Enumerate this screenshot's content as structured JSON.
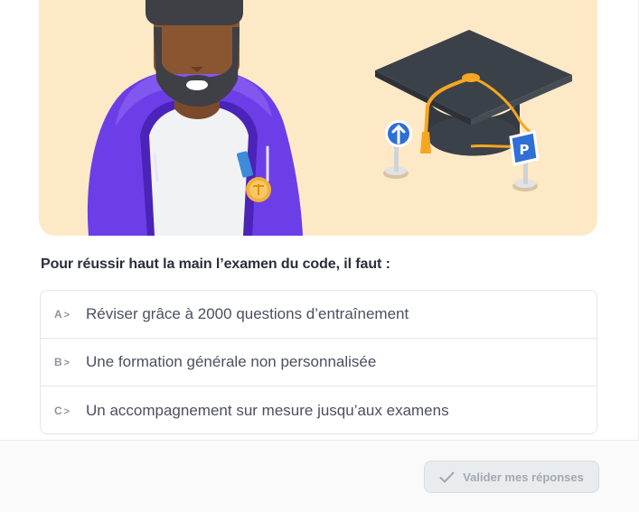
{
  "question": {
    "text": "Pour réussir haut la main l’examen du code, il faut :"
  },
  "answers": [
    {
      "key": "A",
      "label": "Réviser grâce à 2000 questions d’entraînement"
    },
    {
      "key": "B",
      "label": "Une formation générale non personnalisée"
    },
    {
      "key": "C",
      "label": "Un accompagnement sur mesure jusqu’aux examens"
    }
  ],
  "submit": {
    "label": "Valider mes réponses",
    "icon": "check-icon",
    "state": "disabled"
  },
  "hero": {
    "illustration": "student-with-graduation-cap",
    "sign_parking_letter": "P"
  },
  "colors": {
    "hero_background": "#fde9c6",
    "hoodie": "#6c3ee8",
    "cap": "#3b4148",
    "tassel": "#f5a623",
    "border": "#e3e6ea"
  }
}
